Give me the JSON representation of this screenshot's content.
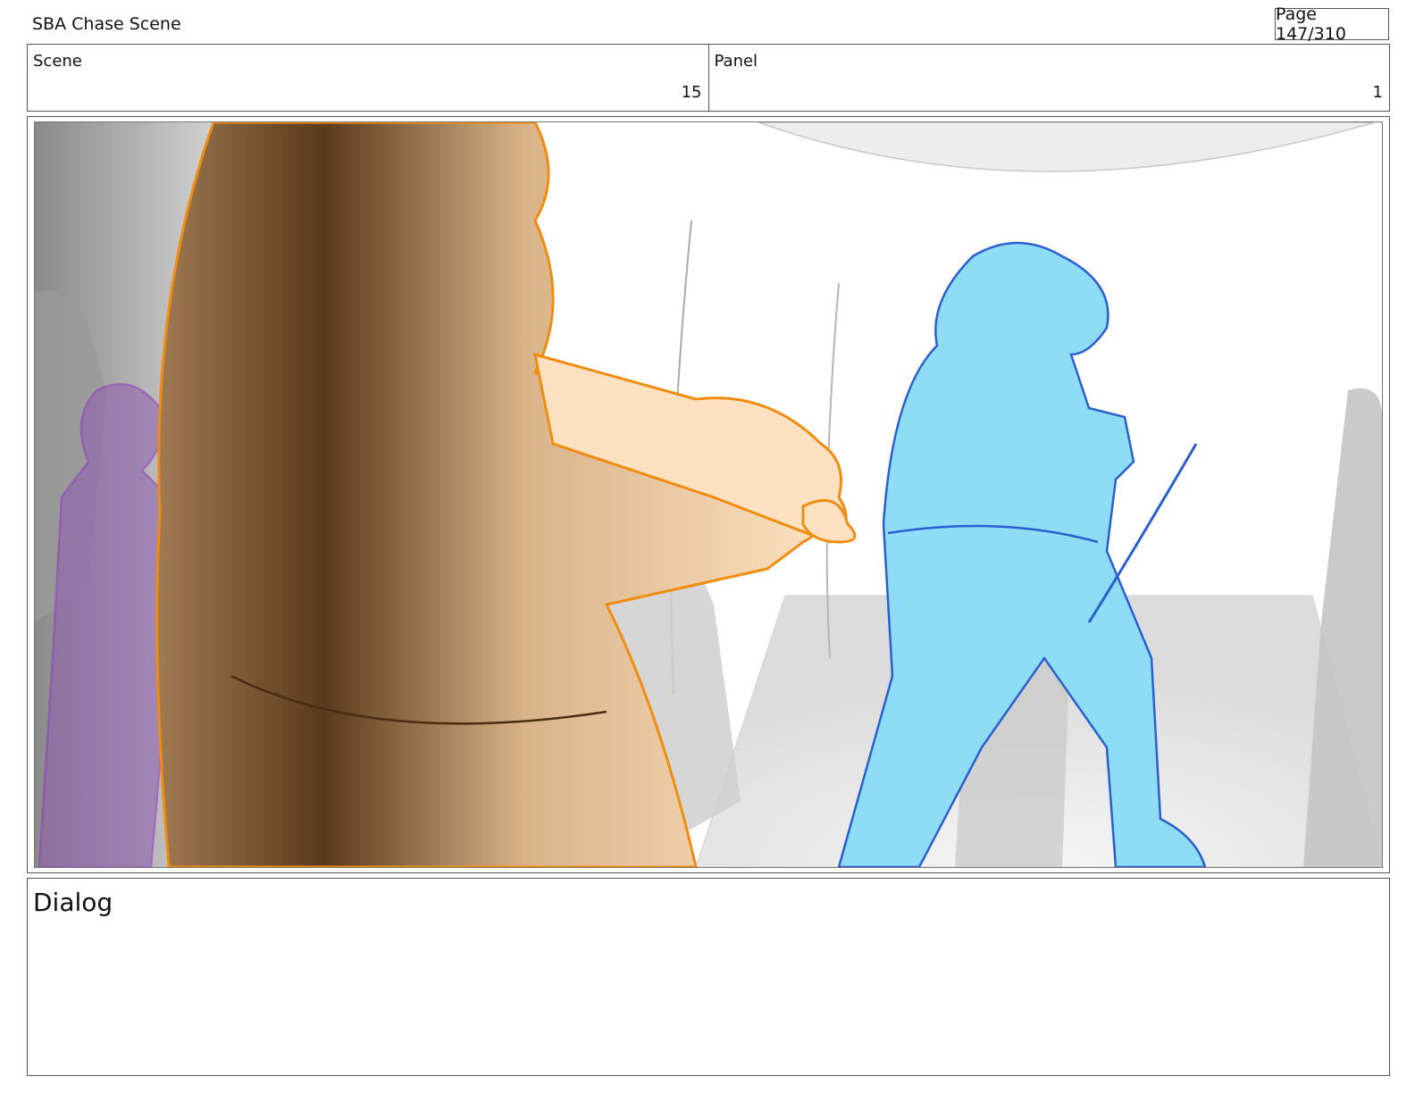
{
  "header": {
    "title": "SBA Chase Scene",
    "page": "Page 147/310"
  },
  "info": {
    "scene_label": "Scene",
    "scene_value": "15",
    "panel_label": "Panel",
    "panel_value": "1"
  },
  "panel": {
    "colors": {
      "foreground_figure": "#f5a64a",
      "foreground_shadow": "#5a3a1c",
      "purple_figure": "#8e5bb0",
      "blue_figure": "#8fdcf6",
      "blue_line": "#2a5fd0",
      "background_gray": "#c9c9c9"
    }
  },
  "dialog": {
    "label": "Dialog"
  }
}
